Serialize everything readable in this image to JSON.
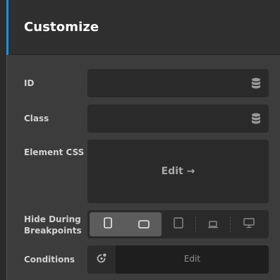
{
  "header": {
    "title": "Customize"
  },
  "fields": {
    "id": {
      "label": "ID",
      "value": ""
    },
    "class": {
      "label": "Class",
      "value": ""
    },
    "element_css": {
      "label": "Element CSS",
      "edit_label": "Edit →"
    },
    "hide_during_breakpoints": {
      "label_line1": "Hide During",
      "label_line2": "Breakpoints",
      "options": [
        {
          "icon": "phone-portrait-icon",
          "active": true
        },
        {
          "icon": "phone-landscape-icon",
          "active": true
        },
        {
          "icon": "tablet-icon",
          "active": false
        },
        {
          "icon": "laptop-icon",
          "active": false
        },
        {
          "icon": "desktop-icon",
          "active": false
        }
      ]
    },
    "conditions": {
      "label": "Conditions",
      "edit_label": "Edit"
    }
  },
  "colors": {
    "accent": "#1e8fe1",
    "panel_bg": "#3c3c3c",
    "header_bg": "#2f2f2f",
    "field_bg": "#2a2a2a",
    "active_segment_bg": "#5c5c5c"
  }
}
